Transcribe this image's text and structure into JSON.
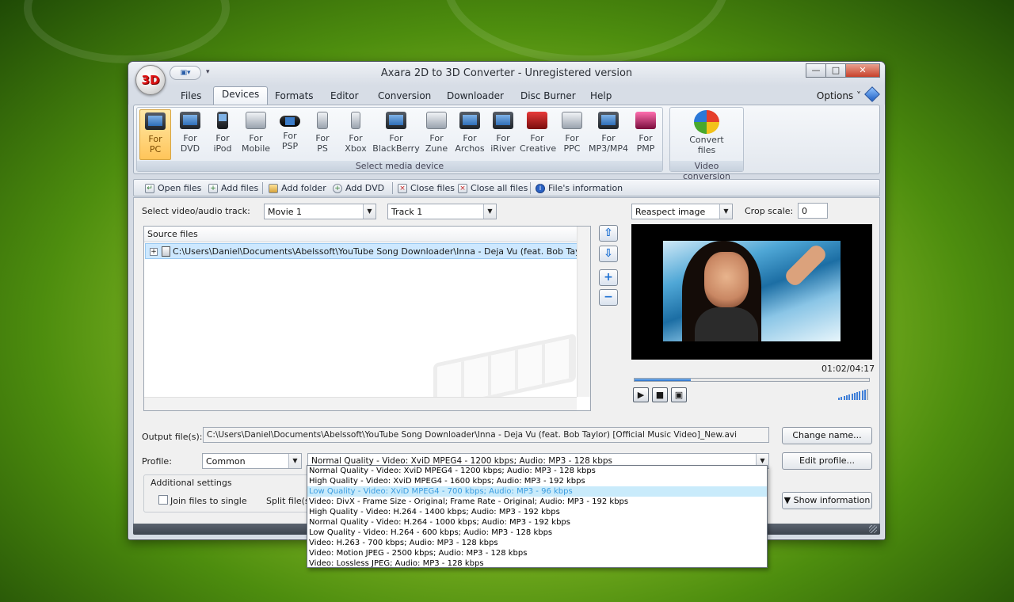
{
  "window": {
    "title": "Axara 2D to 3D Converter - Unregistered version",
    "app_logo": "3D",
    "quick_access": "▾",
    "buttons": {
      "minimize": "—",
      "maximize": "□",
      "close": "✕"
    }
  },
  "menu": {
    "tabs": [
      "Files",
      "Devices",
      "Formats",
      "Editor",
      "Conversion",
      "Downloader",
      "Disc Burner",
      "Help"
    ],
    "active_tab": "Devices",
    "options_label": "Options ˅"
  },
  "ribbon": {
    "devices": [
      {
        "line1": "For",
        "line2": "PC",
        "icon": "pc-icon"
      },
      {
        "line1": "For",
        "line2": "DVD",
        "icon": "dvd-icon"
      },
      {
        "line1": "For",
        "line2": "iPod",
        "icon": "ipod-icon"
      },
      {
        "line1": "For",
        "line2": "Mobile",
        "icon": "mobile-icon"
      },
      {
        "line1": "For",
        "line2": "PSP",
        "icon": "psp-icon"
      },
      {
        "line1": "For",
        "line2": "PS",
        "icon": "ps-icon"
      },
      {
        "line1": "For",
        "line2": "Xbox",
        "icon": "xbox-icon"
      },
      {
        "line1": "For",
        "line2": "BlackBerry",
        "icon": "blackberry-icon"
      },
      {
        "line1": "For",
        "line2": "Zune",
        "icon": "zune-icon"
      },
      {
        "line1": "For",
        "line2": "Archos",
        "icon": "archos-icon"
      },
      {
        "line1": "For",
        "line2": "iRiver",
        "icon": "iriver-icon"
      },
      {
        "line1": "For",
        "line2": "Creative",
        "icon": "creative-icon"
      },
      {
        "line1": "For",
        "line2": "PPC",
        "icon": "ppc-icon"
      },
      {
        "line1": "For",
        "line2": "MP3/MP4",
        "icon": "mp3-mp4-icon"
      },
      {
        "line1": "For",
        "line2": "PMP",
        "icon": "pmp-icon"
      }
    ],
    "devices_caption": "Select media device",
    "convert": {
      "line1": "Convert",
      "line2": "files",
      "icon": "convert-icon"
    },
    "convert_caption": "Video conversion"
  },
  "toolbar": {
    "open_files": "Open files",
    "add_files": "Add files",
    "add_folder": "Add folder",
    "add_dvd": "Add DVD",
    "close_files": "Close files",
    "close_all_files": "Close all files",
    "file_info": "File's information"
  },
  "track": {
    "label": "Select video/audio track:",
    "movie_value": "Movie 1",
    "track_value": "Track 1"
  },
  "source": {
    "header": "Source files",
    "row": "C:\\Users\\Daniel\\Documents\\Abelssoft\\YouTube Song Downloader\\Inna - Deja Vu (feat. Bob Taylor) [Of..."
  },
  "preview": {
    "aspect_value": "Reaspect image",
    "crop_label": "Crop scale:",
    "crop_value": "0",
    "time": "01:02/04:17",
    "progress": 0.24,
    "volume_level": 0.85
  },
  "output": {
    "label": "Output file(s):",
    "value": "C:\\Users\\Daniel\\Documents\\Abelssoft\\YouTube Song Downloader\\Inna - Deja Vu (feat. Bob Taylor) [Official Music Video]_New.avi",
    "change_name": "Change name..."
  },
  "profile": {
    "label": "Profile:",
    "category_value": "Common",
    "selected": "Normal Quality - Video: XviD MPEG4 - 1200 kbps; Audio: MP3 - 128 kbps",
    "edit_profile": "Edit profile...",
    "options": [
      "Normal Quality - Video: XviD MPEG4 - 1200 kbps; Audio: MP3 - 128 kbps",
      "High Quality - Video: XviD MPEG4 - 1600 kbps; Audio: MP3 - 192 kbps",
      "Low Quality - Video: XviD MPEG4 - 700 kbps; Audio: MP3 - 96 kbps",
      "Video: DivX -  Frame Size - Original; Frame Rate - Original; Audio: MP3 - 192 kbps",
      "High Quality - Video: H.264 - 1400 kbps; Audio: MP3 - 192 kbps",
      "Normal Quality - Video: H.264 - 1000 kbps; Audio: MP3 - 192 kbps",
      "Low Quality - Video: H.264 - 600 kbps; Audio: MP3 - 128 kbps",
      "Video: H.263 - 700 kbps; Audio: MP3 - 128 kbps",
      "Video: Motion JPEG - 2500 kbps; Audio: MP3 - 128 kbps",
      "Video: Lossless JPEG; Audio: MP3 - 128 kbps"
    ],
    "highlighted_index": 2
  },
  "additional": {
    "title": "Additional settings",
    "join_label": "Join files to single",
    "split_label": "Split file(s)",
    "show_information": "Show information"
  },
  "colors": {
    "accent": "#2a6fc8",
    "selection": "#cde8ff",
    "active_ribbon": "#ffc55a"
  }
}
